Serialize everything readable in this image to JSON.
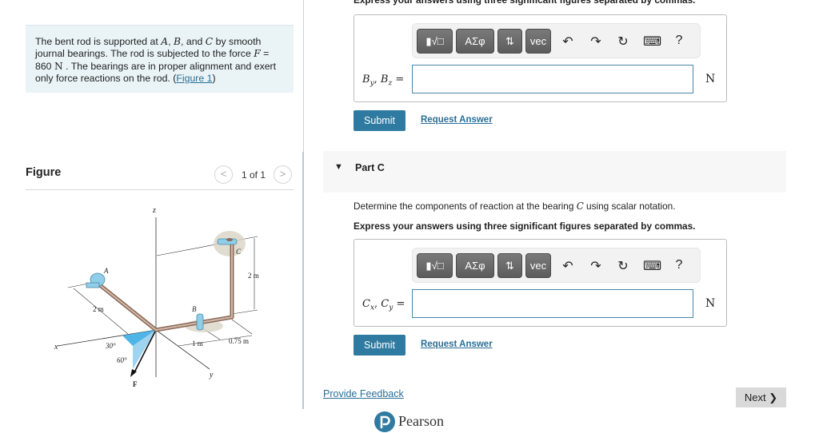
{
  "problem": {
    "text_1": "The bent rod is supported at ",
    "var_A": "A",
    "sep_1": ", ",
    "var_B": "B",
    "sep_2": ", and ",
    "var_C": "C",
    "text_2": " by smooth journal bearings. The rod is subjected to the force ",
    "var_F": "F",
    "text_3": " = 860 ",
    "unit_N": "N",
    "text_4": " . The bearings are in proper alignment and exert only force reactions on the rod. (",
    "figure_link": "Figure 1",
    "text_5": ")"
  },
  "figure": {
    "title": "Figure",
    "pager_text": "1 of 1",
    "prev_icon": "<",
    "next_icon": ">",
    "labels": {
      "z_axis": "z",
      "x_axis": "x",
      "y_axis": "y",
      "point_A": "A",
      "point_B": "B",
      "point_C": "C",
      "dim_2m_left": "2 m",
      "dim_2m_right": "2 m",
      "dim_1m": "1 m",
      "dim_075m": "0.75 m",
      "angle_30": "30°",
      "angle_60": "60°",
      "force_F": "F"
    }
  },
  "part_b": {
    "instruction": "Express your answers using three significant figures separated by commas.",
    "toolbar": {
      "template_btn": "▮√□",
      "greek_btn": "ΑΣφ",
      "sort_btn": "⇅",
      "vec_btn": "vec",
      "undo_icon": "↶",
      "redo_icon": "↷",
      "reset_icon": "↻",
      "keyboard_icon": "⌨",
      "help_icon": "?"
    },
    "label_var1": "B",
    "label_sub1": "y",
    "label_var2": "B",
    "label_sub2": "z",
    "label_eq": " =",
    "input_value": "",
    "unit": "N",
    "submit_label": "Submit",
    "request_label": "Request Answer"
  },
  "part_c": {
    "caret": "▼",
    "title": "Part C",
    "question_1": "Determine the components of reaction at the bearing ",
    "question_var": "C",
    "question_2": " using scalar notation.",
    "instruction": "Express your answers using three significant figures separated by commas.",
    "toolbar": {
      "template_btn": "▮√□",
      "greek_btn": "ΑΣφ",
      "sort_btn": "⇅",
      "vec_btn": "vec",
      "undo_icon": "↶",
      "redo_icon": "↷",
      "reset_icon": "↻",
      "keyboard_icon": "⌨",
      "help_icon": "?"
    },
    "label_var1": "C",
    "label_sub1": "x",
    "label_var2": "C",
    "label_sub2": "y",
    "label_eq": " =",
    "input_value": "",
    "unit": "N",
    "submit_label": "Submit",
    "request_label": "Request Answer"
  },
  "footer": {
    "feedback_link": "Provide Feedback",
    "brand_name": "Pearson",
    "brand_mark": "P",
    "next_label": "Next ❯"
  },
  "colors": {
    "accent": "#2f7aa0",
    "link": "#2a6f97",
    "problem_bg": "#eaf4f7",
    "part_header_bg": "#f7f7f7"
  }
}
